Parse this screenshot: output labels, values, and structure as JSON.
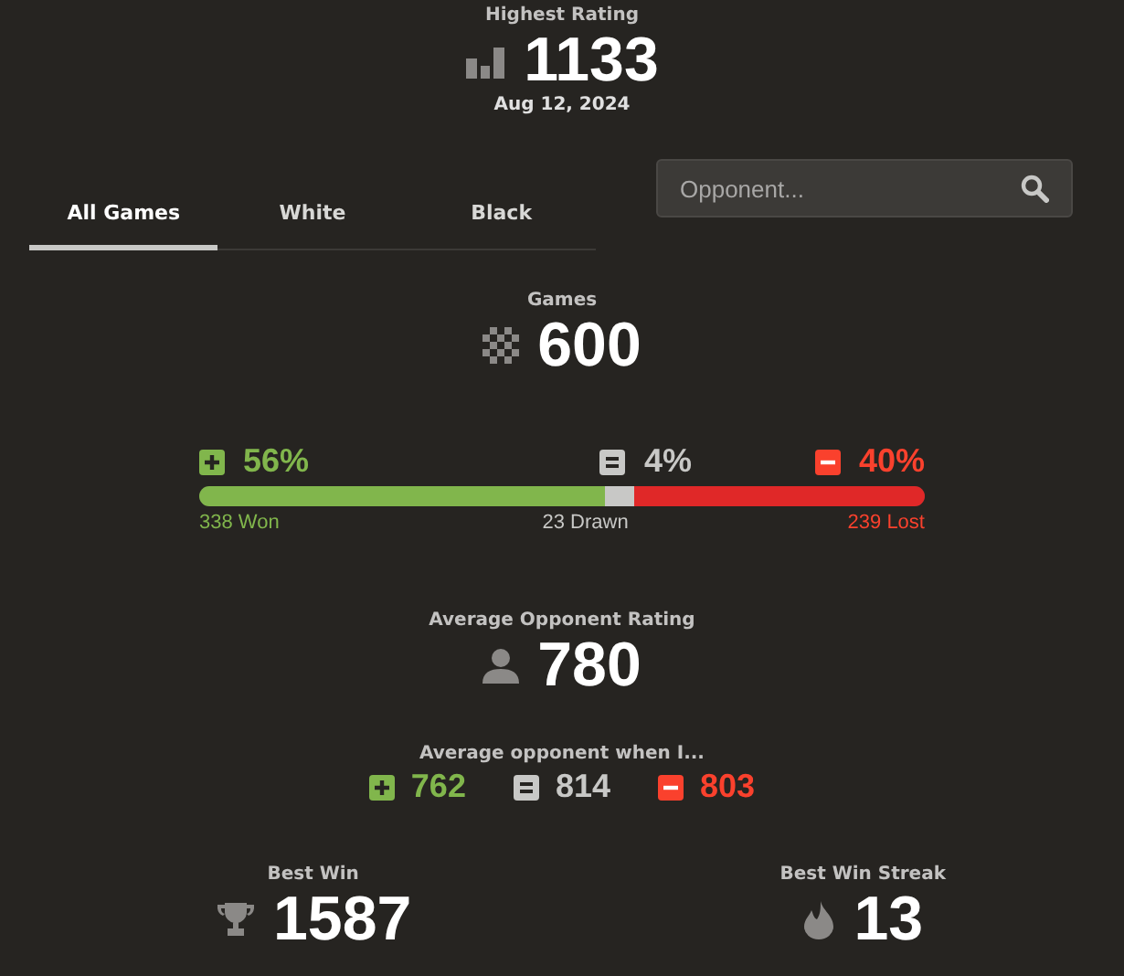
{
  "highest_rating": {
    "label": "Highest Rating",
    "value": "1133",
    "date": "Aug 12, 2024"
  },
  "tabs": [
    {
      "label": "All Games",
      "selected": true
    },
    {
      "label": "White",
      "selected": false
    },
    {
      "label": "Black",
      "selected": false
    }
  ],
  "search": {
    "placeholder": "Opponent..."
  },
  "games": {
    "label": "Games",
    "value": "600"
  },
  "results": [
    {
      "kind": "win",
      "percent": "56%",
      "level": 0.56,
      "count": "338 Won"
    },
    {
      "kind": "draw",
      "percent": "4%",
      "count": "23 Drawn"
    },
    {
      "kind": "loss",
      "percent": "40%",
      "level": 0.4,
      "count": "239 Lost"
    }
  ],
  "average_opponent": {
    "label": "Average Opponent Rating",
    "value": "780"
  },
  "average_when": {
    "label": "Average opponent when I...",
    "items": [
      {
        "kind": "win",
        "value": "762"
      },
      {
        "kind": "draw",
        "value": "814"
      },
      {
        "kind": "loss",
        "value": "803"
      }
    ]
  },
  "bests": [
    {
      "kind": "trophy",
      "label": "Best Win",
      "value": "1587"
    },
    {
      "kind": "flame",
      "label": "Best Win Streak",
      "value": "13"
    }
  ]
}
